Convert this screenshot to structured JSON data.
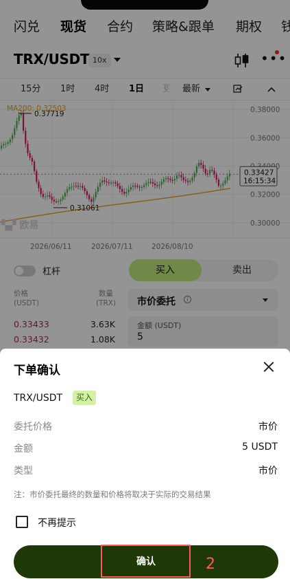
{
  "tabs": [
    "闪兑",
    "现货",
    "合约",
    "策略&跟单",
    "期权",
    "钱"
  ],
  "active_tab": "现货",
  "pair": {
    "name": "TRX/USDT",
    "leverage": "10x"
  },
  "timeframes": [
    "15分",
    "1时",
    "4时",
    "1日",
    "更",
    "最新"
  ],
  "active_timeframe": "1日",
  "chart_data": {
    "type": "candlestick",
    "ma_label": "MA200: 0.32503",
    "y_ticks": [
      "0.38000",
      "0.36000",
      "0.34000",
      "0.32000",
      "0.30000"
    ],
    "y_range": [
      0.298,
      0.3815
    ],
    "x_labels": [
      "2026/06/11",
      "2026/07/11",
      "2026/08/10"
    ],
    "high_label": "0.37719",
    "low_label": "0.31061",
    "last_price": "0.33427",
    "countdown": "16:15:34",
    "ma200": 0.32503,
    "colors": {
      "up": "#4caf50",
      "down": "#d81b60",
      "ma": "#e6a11f"
    }
  },
  "order": {
    "leverage_label": "杠杆",
    "buy_label": "买入",
    "sell_label": "卖出",
    "price_header": "价格",
    "price_unit": "(USDT)",
    "qty_header": "数量",
    "qty_unit": "(TRX)",
    "book": [
      {
        "price": "0.33433",
        "amount": "3.63K"
      },
      {
        "price": "0.33432",
        "amount": "1.08K"
      }
    ],
    "order_type": "市价委托",
    "amount_label": "金额 (USDT)",
    "amount_value": "5"
  },
  "sheet": {
    "title": "下单确认",
    "pair": "TRX/USDT",
    "side_badge": "买入",
    "rows": [
      {
        "label": "委托价格",
        "value": "市价"
      },
      {
        "label": "金额",
        "value": "5 USDT"
      },
      {
        "label": "类型",
        "value": "市价"
      }
    ],
    "note": "注：市价委托最终的数量和价格将取决于实际的交易结果",
    "checkbox_label": "不再提示",
    "confirm_label": "确认",
    "step": "2"
  }
}
